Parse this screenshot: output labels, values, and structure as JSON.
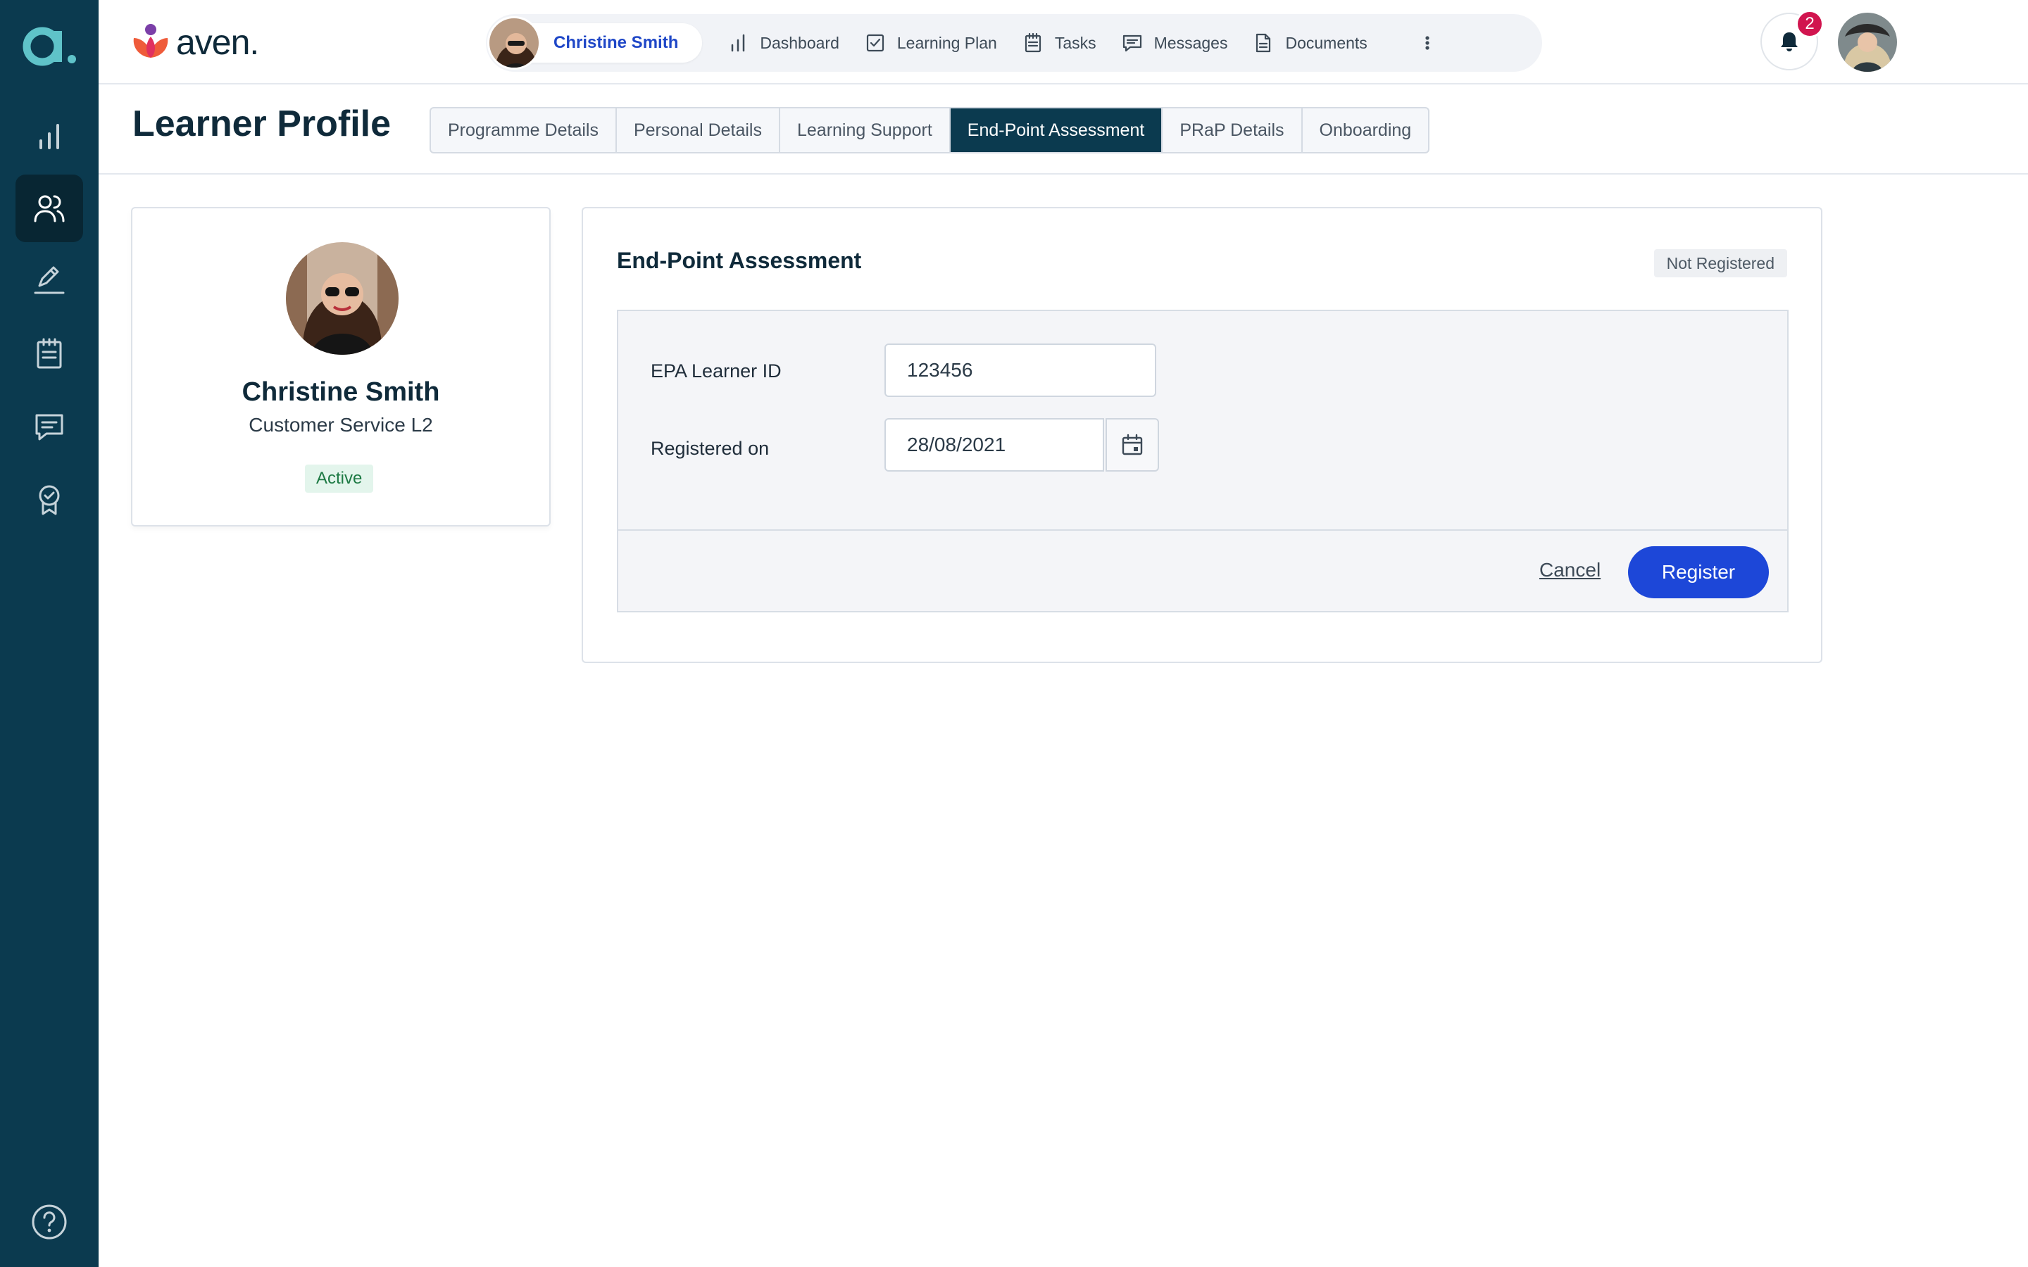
{
  "brand": {
    "name": "aven."
  },
  "sidebar": {
    "items": [
      {
        "name": "reports",
        "icon": "bar-chart-icon"
      },
      {
        "name": "learners",
        "icon": "users-icon",
        "active": true
      },
      {
        "name": "sign",
        "icon": "pen-signature-icon"
      },
      {
        "name": "tasks",
        "icon": "clipboard-icon"
      },
      {
        "name": "messages",
        "icon": "chat-icon"
      },
      {
        "name": "achievements",
        "icon": "award-icon"
      }
    ],
    "help_icon": "help-icon"
  },
  "topnav": {
    "learner_name": "Christine Smith",
    "items": [
      {
        "label": "Dashboard",
        "icon": "bar-chart-icon"
      },
      {
        "label": "Learning Plan",
        "icon": "checkbox-icon"
      },
      {
        "label": "Tasks",
        "icon": "clipboard-icon"
      },
      {
        "label": "Messages",
        "icon": "chat-icon"
      },
      {
        "label": "Documents",
        "icon": "document-icon"
      }
    ],
    "more_icon": "more-vertical-icon"
  },
  "notifications": {
    "count": "2"
  },
  "page": {
    "title": "Learner Profile",
    "tabs": [
      {
        "label": "Programme Details"
      },
      {
        "label": "Personal Details"
      },
      {
        "label": "Learning Support"
      },
      {
        "label": "End-Point Assessment",
        "active": true
      },
      {
        "label": "PRaP Details"
      },
      {
        "label": "Onboarding"
      }
    ]
  },
  "profile": {
    "name": "Christine Smith",
    "course": "Customer Service L2",
    "status": "Active"
  },
  "epa": {
    "title": "End-Point Assessment",
    "status": "Not Registered",
    "learner_id_label": "EPA Learner ID",
    "learner_id_value": "123456",
    "registered_on_label": "Registered on",
    "registered_on_value": "28/08/2021",
    "cancel_label": "Cancel",
    "register_label": "Register"
  },
  "colors": {
    "sidebar": "#0b3a4f",
    "primary_button": "#1d47d8",
    "learner_name": "#1f47c7",
    "badge": "#d1154f",
    "active_status_bg": "#e3f5ec",
    "active_status_text": "#1d7a44"
  }
}
